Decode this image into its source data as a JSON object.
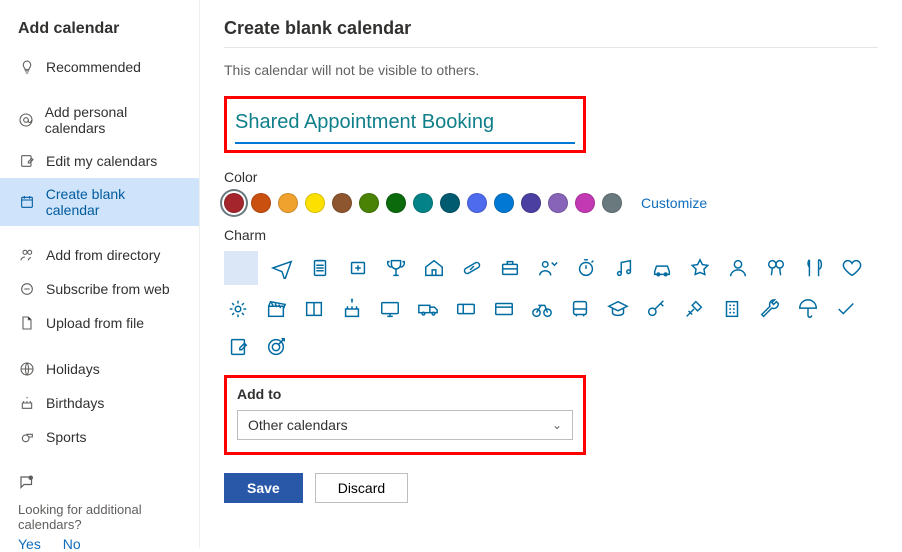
{
  "sidebar": {
    "title": "Add calendar",
    "items": [
      {
        "label": "Recommended",
        "icon": "lightbulb"
      },
      {
        "label": "Add personal calendars",
        "icon": "at-sign",
        "gap_before": true
      },
      {
        "label": "Edit my calendars",
        "icon": "note-edit"
      },
      {
        "label": "Create blank calendar",
        "icon": "calendar-blank",
        "active": true
      },
      {
        "label": "Add from directory",
        "icon": "people-search",
        "gap_before": true
      },
      {
        "label": "Subscribe from web",
        "icon": "minus-circle"
      },
      {
        "label": "Upload from file",
        "icon": "file-upload"
      },
      {
        "label": "Holidays",
        "icon": "globe",
        "gap_before": true
      },
      {
        "label": "Birthdays",
        "icon": "cake"
      },
      {
        "label": "Sports",
        "icon": "sports-whistle"
      }
    ],
    "extra_prompt": "Looking for additional calendars?",
    "extra_yes": "Yes",
    "extra_no": "No"
  },
  "main": {
    "title": "Create blank calendar",
    "info": "This calendar will not be visible to others.",
    "calendar_name": "Shared Appointment Booking",
    "color_label": "Color",
    "customize_label": "Customize",
    "colors": [
      "#a4262c",
      "#ca5010",
      "#f0a22e",
      "#fce100",
      "#8e562e",
      "#498205",
      "#0b6a0b",
      "#038387",
      "#005b70",
      "#4f6bed",
      "#0078d4",
      "#4b3fa1",
      "#8764b8",
      "#c239b3",
      "#69797e"
    ],
    "selected_color_index": 0,
    "charm_label": "Charm",
    "addto_label": "Add to",
    "addto_value": "Other calendars",
    "save": "Save",
    "discard": "Discard"
  }
}
